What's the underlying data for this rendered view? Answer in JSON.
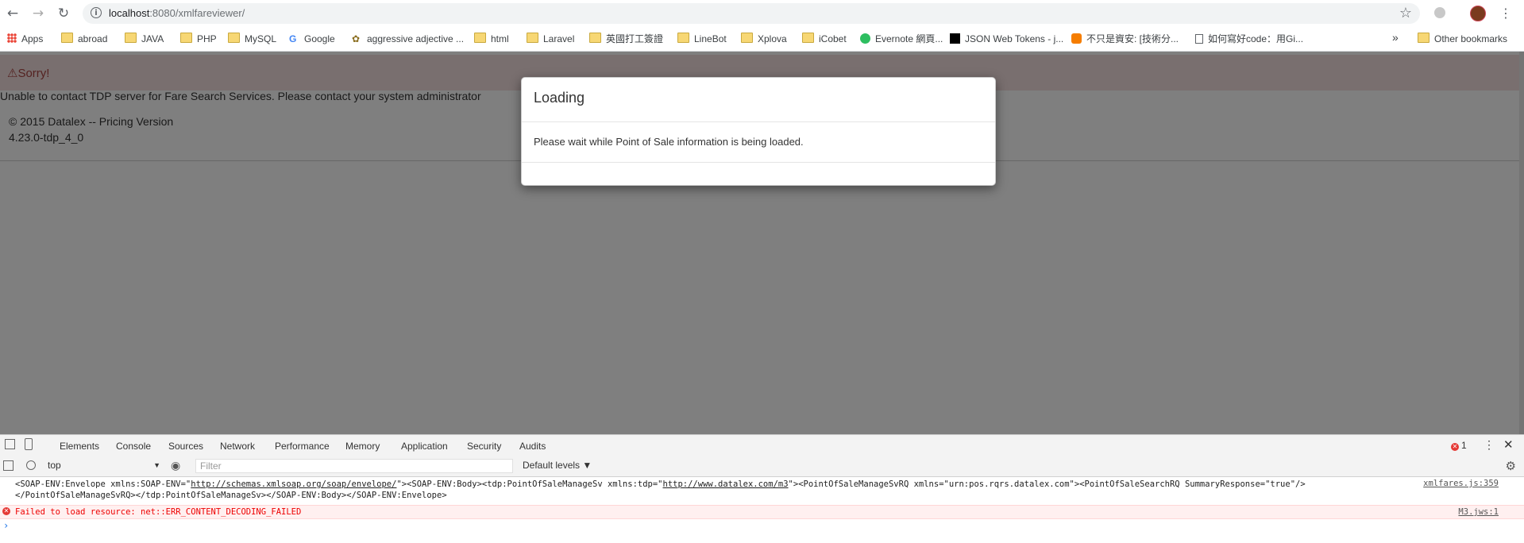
{
  "browser": {
    "url_host": "localhost",
    "url_path": ":8080/xmlfareviewer/"
  },
  "bookmarks": [
    {
      "label": "Apps",
      "icon": "apps-grid-icon"
    },
    {
      "label": "abroad",
      "icon": "folder-icon"
    },
    {
      "label": "JAVA",
      "icon": "folder-icon"
    },
    {
      "label": "PHP",
      "icon": "folder-icon"
    },
    {
      "label": "MySQL",
      "icon": "folder-icon"
    },
    {
      "label": "Google",
      "icon": "google-icon"
    },
    {
      "label": "aggressive adjective ...",
      "icon": "site-icon"
    },
    {
      "label": "html",
      "icon": "folder-icon"
    },
    {
      "label": "Laravel",
      "icon": "folder-icon"
    },
    {
      "label": "英國打工簽證",
      "icon": "folder-icon"
    },
    {
      "label": "LineBot",
      "icon": "folder-icon"
    },
    {
      "label": "Xplova",
      "icon": "folder-icon"
    },
    {
      "label": "iCobet",
      "icon": "folder-icon"
    },
    {
      "label": "Evernote 網頁...",
      "icon": "evernote-icon"
    },
    {
      "label": "JSON Web Tokens - j...",
      "icon": "jwt-icon"
    },
    {
      "label": "不只是資安: [技術分...",
      "icon": "blogger-icon"
    },
    {
      "label": "如何寫好code：用Gi...",
      "icon": "page-icon"
    }
  ],
  "other_bookmarks": "Other bookmarks",
  "page": {
    "sorry": "Sorry!",
    "error_message": "Unable to contact TDP server for Fare Search Services. Please contact your system administrator",
    "footer_line1": "© 2015 Datalex -- Pricing Version",
    "footer_line2": "4.23.0-tdp_4_0"
  },
  "modal": {
    "title": "Loading",
    "body": "Please wait while Point of Sale information is being loaded."
  },
  "devtools": {
    "tabs": [
      "Elements",
      "Console",
      "Sources",
      "Network",
      "Performance",
      "Memory",
      "Application",
      "Security",
      "Audits"
    ],
    "active_tab": "Console",
    "error_count": "1",
    "context": "top",
    "filter_placeholder": "Filter",
    "levels": "Default levels ▼",
    "log1_text_a": "<SOAP-ENV:Envelope xmlns:SOAP-ENV=\"",
    "log1_link_a": "http://schemas.xmlsoap.org/soap/envelope/",
    "log1_text_b": "\"><SOAP-ENV:Body><tdp:PointOfSaleManageSv xmlns:tdp=\"",
    "log1_link_b": "http://www.datalex.com/m3",
    "log1_text_c": "\"><PointOfSaleManageSvRQ xmlns=\"urn:pos.rqrs.datalex.com\"><PointOfSaleSearchRQ SummaryResponse=\"true\"/>",
    "log1_line2": "</PointOfSaleManageSvRQ></tdp:PointOfSaleManageSv></SOAP-ENV:Body></SOAP-ENV:Envelope>",
    "log1_source": "xmlfares.js:359",
    "log2_text": "Failed to load resource: net::ERR_CONTENT_DECODING_FAILED",
    "log2_source": "M3.jws:1"
  }
}
